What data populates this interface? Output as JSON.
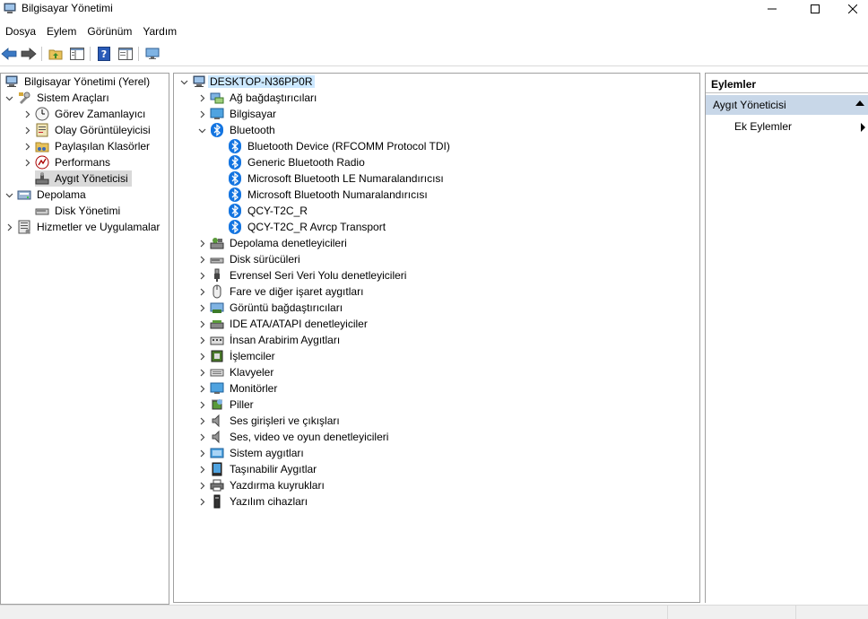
{
  "window": {
    "title": "Bilgisayar Yönetimi",
    "icon": "computer-management-icon"
  },
  "menu": [
    "Dosya",
    "Eylem",
    "Görünüm",
    "Yardım"
  ],
  "toolbar": [
    "back-icon",
    "forward-icon",
    "up-folder-icon",
    "show-hide-tree-icon",
    "help-icon",
    "properties-icon",
    "monitor-icon"
  ],
  "left_tree": {
    "root": "Bilgisayar Yönetimi (Yerel)",
    "items": [
      {
        "label": "Sistem Araçları",
        "icon": "tools-icon"
      },
      {
        "label": "Görev Zamanlayıcı",
        "icon": "clock-icon"
      },
      {
        "label": "Olay Görüntüleyicisi",
        "icon": "event-viewer-icon"
      },
      {
        "label": "Paylaşılan Klasörler",
        "icon": "shared-folder-icon"
      },
      {
        "label": "Performans",
        "icon": "performance-icon"
      },
      {
        "label": "Aygıt Yöneticisi",
        "icon": "device-manager-icon"
      },
      {
        "label": "Depolama",
        "icon": "storage-icon"
      },
      {
        "label": "Disk Yönetimi",
        "icon": "disk-icon"
      },
      {
        "label": "Hizmetler ve Uygulamalar",
        "icon": "services-icon"
      }
    ]
  },
  "device_tree": {
    "root": "DESKTOP-N36PP0R",
    "categories_top": [
      {
        "label": "Ağ bağdaştırıcıları",
        "icon": "network-adapter-icon"
      },
      {
        "label": "Bilgisayar",
        "icon": "computer-icon"
      },
      {
        "label": "Bluetooth",
        "icon": "bluetooth-icon"
      }
    ],
    "bluetooth_devices": [
      "Bluetooth Device (RFCOMM Protocol TDI)",
      "Generic Bluetooth Radio",
      "Microsoft Bluetooth LE Numaralandırıcısı",
      "Microsoft Bluetooth Numaralandırıcısı",
      "QCY-T2C_R",
      "QCY-T2C_R Avrcp Transport"
    ],
    "categories_rest": [
      {
        "label": "Depolama denetleyicileri",
        "icon": "storage-controller-icon"
      },
      {
        "label": "Disk sürücüleri",
        "icon": "disk-drive-icon"
      },
      {
        "label": "Evrensel Seri Veri Yolu denetleyicileri",
        "icon": "usb-icon"
      },
      {
        "label": "Fare ve diğer işaret aygıtları",
        "icon": "mouse-icon"
      },
      {
        "label": "Görüntü bağdaştırıcıları",
        "icon": "display-adapter-icon"
      },
      {
        "label": "IDE ATA/ATAPI denetleyiciler",
        "icon": "ide-icon"
      },
      {
        "label": "İnsan Arabirim Aygıtları",
        "icon": "hid-icon"
      },
      {
        "label": "İşlemciler",
        "icon": "processor-icon"
      },
      {
        "label": "Klavyeler",
        "icon": "keyboard-icon"
      },
      {
        "label": "Monitörler",
        "icon": "monitor-icon"
      },
      {
        "label": "Piller",
        "icon": "battery-icon"
      },
      {
        "label": "Ses girişleri ve çıkışları",
        "icon": "speaker-icon"
      },
      {
        "label": "Ses, video ve oyun denetleyicileri",
        "icon": "speaker-icon"
      },
      {
        "label": "Sistem aygıtları",
        "icon": "system-device-icon"
      },
      {
        "label": "Taşınabilir Aygıtlar",
        "icon": "portable-device-icon"
      },
      {
        "label": "Yazdırma kuyrukları",
        "icon": "printer-icon"
      },
      {
        "label": "Yazılım cihazları",
        "icon": "software-device-icon"
      }
    ]
  },
  "actions": {
    "header": "Eylemler",
    "section": "Aygıt Yöneticisi",
    "item": "Ek Eylemler"
  },
  "colors": {
    "bluetooth": "#1475e1",
    "selection": "#d9d9d9",
    "root_highlight": "#cce8ff",
    "action_section_bg": "#c8d7e8"
  }
}
